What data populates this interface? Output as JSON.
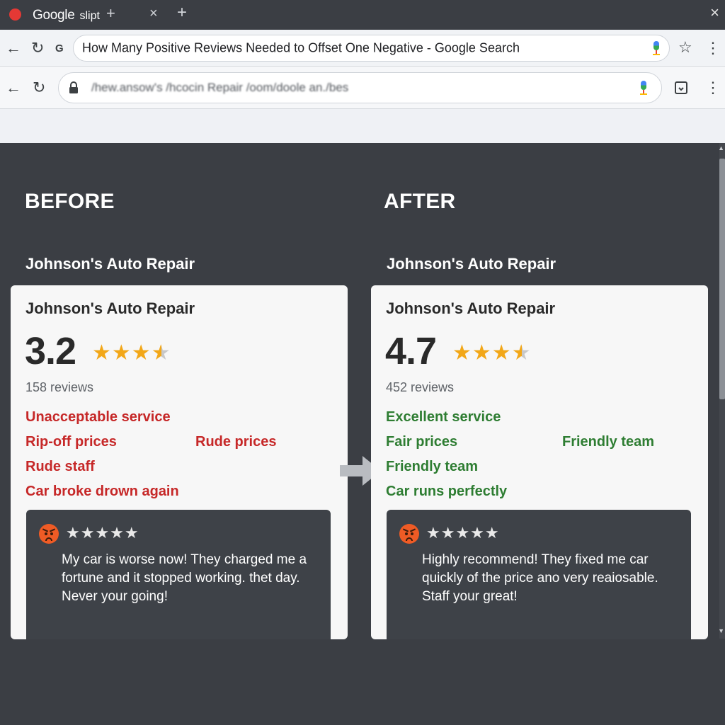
{
  "browser": {
    "tab": {
      "brand": "Google",
      "suffix": "slipt",
      "plus_glyph": "+",
      "close_glyph": "×"
    },
    "new_tab_glyph": "+",
    "window_close_glyph": "×",
    "search_bar": {
      "query": "How Many Positive Reviews Needed to Offset One Negative - Google Search"
    },
    "address_bar": {
      "url": "/hew.ansow's /hcocin Repair /oom/doole an./bes"
    },
    "icons": {
      "back": "←",
      "reload": "↻",
      "star": "☆",
      "menu": "⋮",
      "lock": "lock-icon",
      "mic": "mic-icon",
      "cast": "cast-icon"
    }
  },
  "before": {
    "heading": "BEFORE",
    "business_label": "Johnson's Auto Repair",
    "card": {
      "name": "Johnson's Auto Repair",
      "rating": "3.2",
      "stars": "3.5 of 5",
      "review_count": "158 reviews",
      "tags": [
        "Unacceptable service",
        "Rip-off prices",
        "Rude prices",
        "Rude staff",
        "Car broke drown again"
      ],
      "review": {
        "stars": "★★★★★",
        "text": "My car is worse now! They charged me a fortune and it stopped working. thet day. Never your going!"
      }
    }
  },
  "after": {
    "heading": "AFTER",
    "business_label": "Johnson's Auto Repair",
    "card": {
      "name": "Johnson's Auto Repair",
      "rating": "4.7",
      "stars": "3.5 of 5",
      "review_count": "452 reviews",
      "tags": [
        "Excellent service",
        "Fair prices",
        "Friendly team",
        "Friendly team",
        "Car runs perfectly"
      ],
      "review": {
        "stars": "★★★★★",
        "text": "Highly recommend! They fixed me car quickly of the price ano very reaiosable. Staff your great!"
      }
    }
  },
  "colors": {
    "negative": "#c62828",
    "positive": "#2e7d32",
    "star": "#f2a718",
    "background": "#3b3e44"
  }
}
